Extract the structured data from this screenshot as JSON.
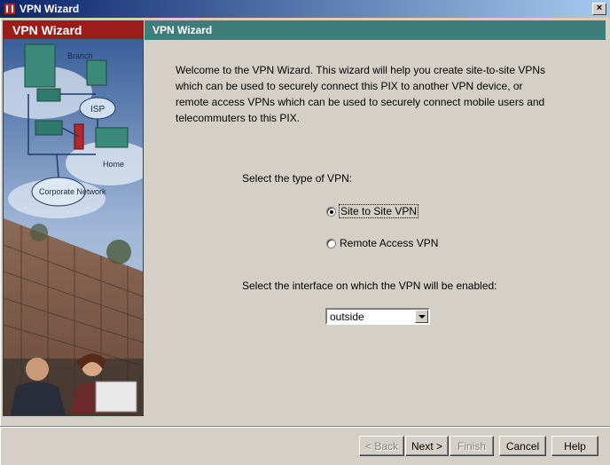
{
  "window": {
    "title": "VPN Wizard",
    "close_glyph": "×"
  },
  "left_panel": {
    "header": "VPN Wizard",
    "illustration": {
      "labels": [
        "Branch",
        "ISP",
        "Home",
        "Corporate Network"
      ]
    }
  },
  "right_header": "VPN Wizard",
  "intro_text": "Welcome to the VPN Wizard. This wizard will help you create site-to-site VPNs which can be used to securely connect this PIX to another VPN device, or remote access VPNs which can be used to securely connect mobile users and telecommuters to this PIX.",
  "vpn_type": {
    "label": "Select the type of VPN:",
    "options": [
      {
        "label": "Site to Site VPN",
        "selected": true
      },
      {
        "label": "Remote Access VPN",
        "selected": false
      }
    ]
  },
  "interface": {
    "label": "Select the interface on which the VPN will be enabled:",
    "selected": "outside"
  },
  "buttons": {
    "back": "< Back",
    "next": "Next >",
    "finish": "Finish",
    "cancel": "Cancel",
    "help": "Help"
  },
  "colors": {
    "left_header": "#9c1c1c",
    "right_header": "#3f7c7c",
    "dialog_bg": "#d4d0c8"
  }
}
